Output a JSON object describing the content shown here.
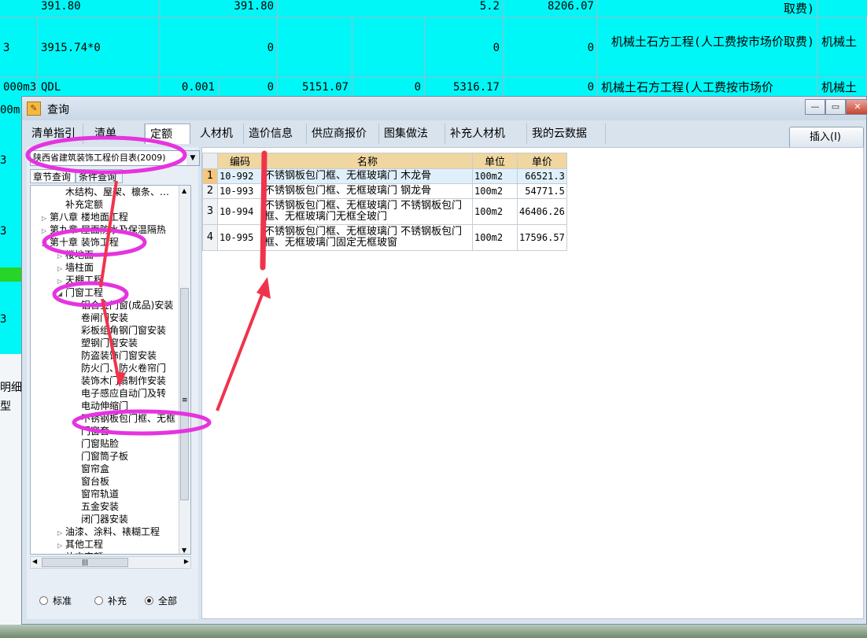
{
  "background": {
    "rows": [
      {
        "cells": [
          "3",
          "3915.74*0",
          "",
          "0",
          "",
          "",
          "0",
          "0",
          "机械土石方工程(人工费按市场价取费)",
          "机械土"
        ]
      },
      {
        "cells": [
          "000m3",
          "QDL",
          "0.001",
          "0",
          "5151.07",
          "0",
          "5316.17",
          "0",
          "机械土石方工程(人工费按市场价",
          "机械土"
        ]
      }
    ],
    "top_partial": {
      "c1": "391.80",
      "c3": "391.80",
      "c6": "5.2",
      "c7": "8206.07",
      "c8": "取费)"
    },
    "side_labels": [
      "3",
      "3",
      "3",
      "00m",
      "明细",
      "型"
    ]
  },
  "dialog": {
    "title": "查询",
    "tabs": [
      "清单指引",
      "清单",
      "定额",
      "人材机",
      "造价信息",
      "供应商报价",
      "图集做法",
      "补充人材机",
      "我的云数据"
    ],
    "active_tab": "定额",
    "insert_button": "插入(I)",
    "library_select": "陕西省建筑装饰工程价目表(2009)",
    "subtabs": [
      "章节查询",
      "条件查询"
    ],
    "tree": [
      {
        "label": "木结构、屋架、檩条、…",
        "level": 2,
        "exp": ""
      },
      {
        "label": "补充定额",
        "level": 2,
        "exp": ""
      },
      {
        "label": "第八章 楼地面工程",
        "level": 1,
        "exp": "▷"
      },
      {
        "label": "第九章 屋面防水及保温隔热",
        "level": 1,
        "exp": "▷"
      },
      {
        "label": "第十章 装饰工程",
        "level": 1,
        "exp": "◢"
      },
      {
        "label": "楼地面",
        "level": 2,
        "exp": "▷"
      },
      {
        "label": "墙柱面",
        "level": 2,
        "exp": "▷"
      },
      {
        "label": "天棚工程",
        "level": 2,
        "exp": "▷"
      },
      {
        "label": "门窗工程",
        "level": 2,
        "exp": "◢"
      },
      {
        "label": "铝合金门窗(成品)安装",
        "level": 3,
        "exp": ""
      },
      {
        "label": "卷闸门安装",
        "level": 3,
        "exp": ""
      },
      {
        "label": "彩板组角钢门窗安装",
        "level": 3,
        "exp": ""
      },
      {
        "label": "塑钢门窗安装",
        "level": 3,
        "exp": ""
      },
      {
        "label": "防盗装饰门窗安装",
        "level": 3,
        "exp": ""
      },
      {
        "label": "防火门、防火卷帘门",
        "level": 3,
        "exp": ""
      },
      {
        "label": "装饰木门扇制作安装",
        "level": 3,
        "exp": ""
      },
      {
        "label": "电子感应自动门及转",
        "level": 3,
        "exp": ""
      },
      {
        "label": "电动伸缩门",
        "level": 3,
        "exp": ""
      },
      {
        "label": "不锈钢板包门框、无框",
        "level": 3,
        "exp": ""
      },
      {
        "label": "门窗套",
        "level": 3,
        "exp": ""
      },
      {
        "label": "门窗贴脸",
        "level": 3,
        "exp": ""
      },
      {
        "label": "门窗筒子板",
        "level": 3,
        "exp": ""
      },
      {
        "label": "窗帘盒",
        "level": 3,
        "exp": ""
      },
      {
        "label": "窗台板",
        "level": 3,
        "exp": ""
      },
      {
        "label": "窗帘轨道",
        "level": 3,
        "exp": ""
      },
      {
        "label": "五金安装",
        "level": 3,
        "exp": ""
      },
      {
        "label": "闭门器安装",
        "level": 3,
        "exp": ""
      },
      {
        "label": "油漆、涂料、裱糊工程",
        "level": 2,
        "exp": "▷"
      },
      {
        "label": "其他工程",
        "level": 2,
        "exp": "▷"
      },
      {
        "label": "补充定额",
        "level": 2,
        "exp": ""
      }
    ],
    "radios": [
      {
        "label": "标准",
        "on": false
      },
      {
        "label": "补充",
        "on": false
      },
      {
        "label": "全部",
        "on": true
      }
    ],
    "grid": {
      "headers": [
        "编码",
        "名称",
        "单位",
        "单价"
      ],
      "rows": [
        {
          "no": "1",
          "code": "10-992",
          "name": "不锈钢板包门框、无框玻璃门 木龙骨",
          "unit": "100m2",
          "price": "66521.3"
        },
        {
          "no": "2",
          "code": "10-993",
          "name": "不锈钢板包门框、无框玻璃门 钢龙骨",
          "unit": "100m2",
          "price": "54771.5"
        },
        {
          "no": "3",
          "code": "10-994",
          "name": "不锈钢板包门框、无框玻璃门 不锈钢板包门框、无框玻璃门无框全玻门",
          "unit": "100m2",
          "price": "46406.26"
        },
        {
          "no": "4",
          "code": "10-995",
          "name": "不锈钢板包门框、无框玻璃门 不锈钢板包门框、无框玻璃门固定无框玻窗",
          "unit": "100m2",
          "price": "17596.57"
        }
      ]
    }
  },
  "colors": {
    "highlight_row": "#00f7f7",
    "annotation": "#e633e0",
    "arrow": "#f0334c",
    "header": "#f0d6a0"
  }
}
